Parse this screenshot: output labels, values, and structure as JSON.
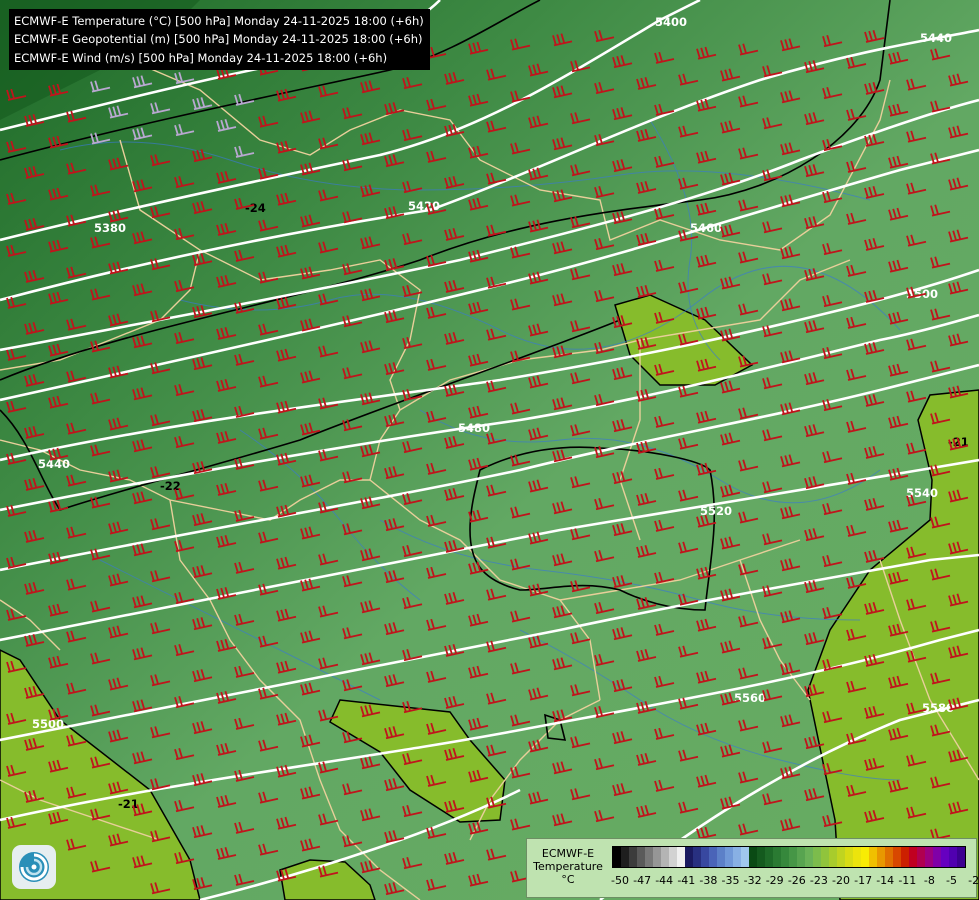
{
  "header": {
    "lines": [
      "ECMWF-E Temperature (°C) [500 hPa] Monday 24-11-2025 18:00 (+6h)",
      "ECMWF-E Geopotential (m) [500 hPa] Monday 24-11-2025 18:00 (+6h)",
      "ECMWF-E Wind (m/s) [500 hPa] Monday 24-11-2025 18:00 (+6h)"
    ]
  },
  "map": {
    "geopotential_labels": [
      "5380",
      "5420",
      "5400",
      "5440",
      "5460",
      "5480",
      "5500",
      "5520",
      "5540",
      "5560",
      "5580"
    ],
    "temperature_labels": [
      "-24",
      "-22",
      "-21"
    ],
    "colors": {
      "white_contour": "#ffffff",
      "black_contour": "#000000",
      "wind_barb": "#c0141c",
      "wind_barb_calm": "#b8a8d0",
      "border": "#e8cf9a",
      "river": "#3a7ad0"
    }
  },
  "legend": {
    "title_lines": [
      "ECMWF-E",
      "Temperature",
      "°C"
    ],
    "ticks": [
      "-50",
      "-47",
      "-44",
      "-41",
      "-38",
      "-35",
      "-32",
      "-29",
      "-26",
      "-23",
      "-20",
      "-17",
      "-14",
      "-11",
      "-8",
      "-5",
      "-2"
    ],
    "swatch_colors": [
      "#000000",
      "#1e1e1e",
      "#3c3c3c",
      "#5a5a5a",
      "#787878",
      "#969696",
      "#b4b4b4",
      "#d2d2d2",
      "#f0f0f0",
      "#1a1a60",
      "#283080",
      "#3848a0",
      "#4a64b8",
      "#5c80c8",
      "#7098d8",
      "#88b0e4",
      "#a0c8ee",
      "#0a4a14",
      "#145a1e",
      "#1e6a28",
      "#2a7a32",
      "#36883c",
      "#469646",
      "#58a450",
      "#6ab258",
      "#7cbc4c",
      "#90c43c",
      "#a8cc2c",
      "#c0d420",
      "#d8dc14",
      "#ece40c",
      "#f8ec04",
      "#f0c000",
      "#e89800",
      "#e07000",
      "#d84800",
      "#cc2000",
      "#c00020",
      "#b00050",
      "#9c0080",
      "#8000a8",
      "#6600c0",
      "#5000b0",
      "#3c0090"
    ]
  },
  "logo": {
    "icon": "ecmwf-swirl-icon"
  }
}
